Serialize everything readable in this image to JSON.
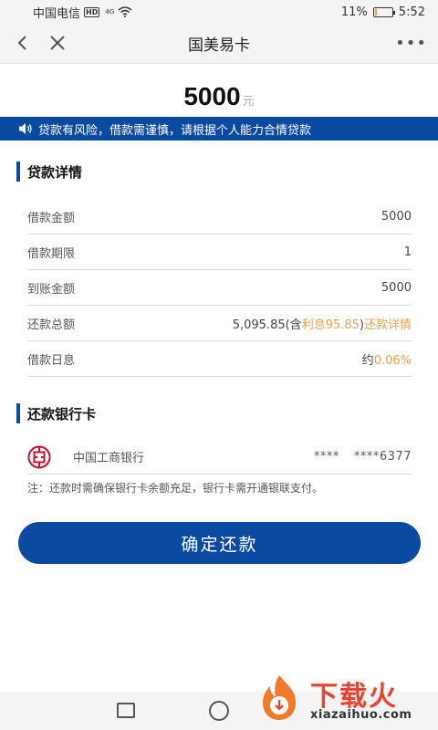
{
  "status_bar": {
    "carrier": "中国电信",
    "hd_badge": "HD",
    "network": "4G",
    "battery_percent": "11%",
    "battery_level": 0.11,
    "time": "5:52"
  },
  "nav": {
    "title": "国美易卡",
    "more_label": "•••"
  },
  "amount": {
    "value": "5000",
    "unit": "元"
  },
  "notice": {
    "text": "贷款有风险，借款需谨慎，请根据个人能力合情贷款"
  },
  "loan_details": {
    "title": "贷款详情",
    "rows": [
      {
        "label": "借款金额",
        "value": "5000"
      },
      {
        "label": "借款期限",
        "value": "1"
      },
      {
        "label": "到账金额",
        "value": "5000"
      }
    ],
    "total": {
      "label": "还款总额",
      "value_prefix": "5,095.85(含",
      "interest": "利息95.85",
      "suffix": ")",
      "details_link": "还款详情"
    },
    "daily_interest": {
      "label": "借款日息",
      "prefix": "约",
      "rate": "0.06%"
    }
  },
  "repayment_card": {
    "title": "还款银行卡",
    "bank_name": "中国工商银行",
    "mask": "****",
    "card_number": "****6377",
    "note": "注：还款时需确保银行卡余额充足，银行卡需开通银联支付。"
  },
  "confirm_button": {
    "label": "确定还款"
  },
  "watermark": {
    "text": "下载火",
    "url": "xiazaihuo.com"
  },
  "colors": {
    "primary_blue": "#0b4aa1",
    "accent_orange": "#f0a048",
    "bank_red": "#c8102e"
  }
}
